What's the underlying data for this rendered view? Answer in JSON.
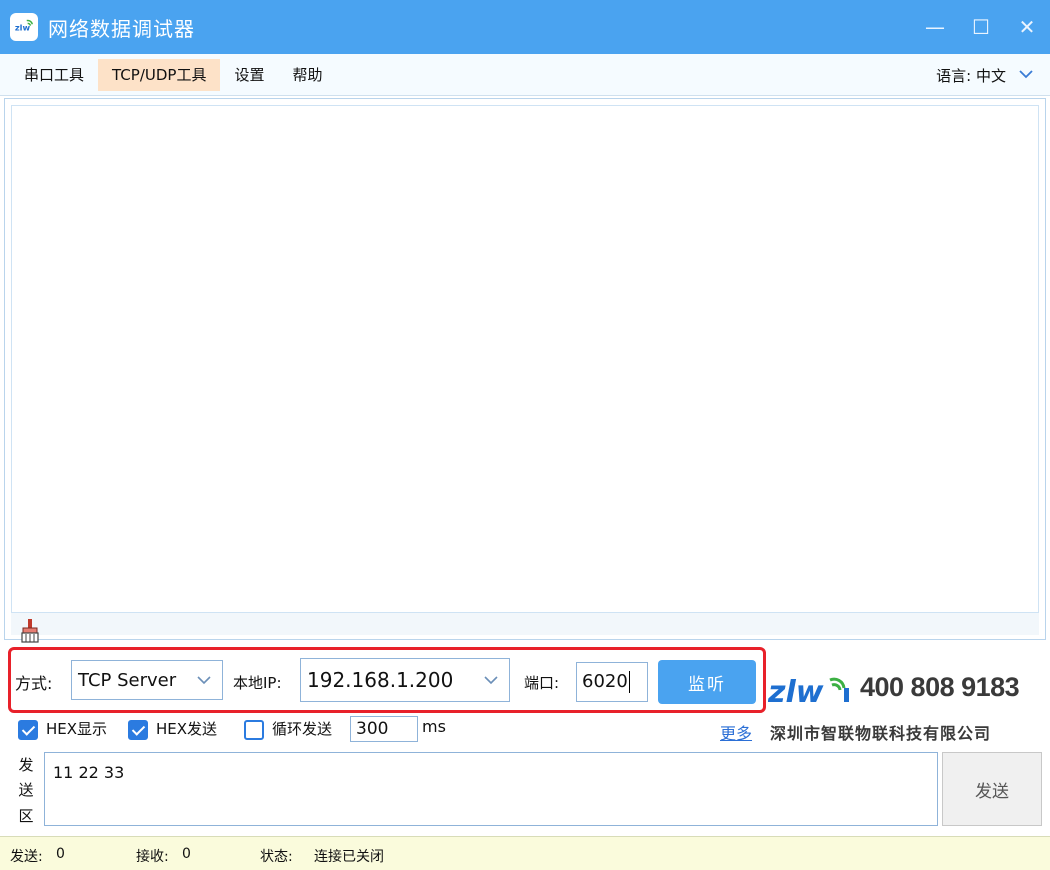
{
  "window": {
    "title": "网络数据调试器",
    "minimize": "—",
    "maximize": "☐",
    "close": "✕"
  },
  "menu": {
    "items": [
      "串口工具",
      "TCP/UDP工具",
      "设置",
      "帮助"
    ],
    "active": "TCP/UDP工具",
    "language_label": "语言: 中文"
  },
  "config": {
    "mode_label": "方式:",
    "mode_value": "TCP Server",
    "local_ip_label": "本地IP:",
    "local_ip_value": "192.168.1.200",
    "port_label": "端口:",
    "port_value": "6020",
    "listen_button": "监听"
  },
  "brand": {
    "phone": "400 808 9183",
    "company": "深圳市智联物联科技有限公司",
    "more_link": "更多"
  },
  "options": {
    "hex_display_label": "HEX显示",
    "hex_display_checked": true,
    "hex_send_label": "HEX发送",
    "hex_send_checked": true,
    "loop_send_label": "循环发送",
    "loop_send_checked": false,
    "interval_value": "300",
    "interval_unit": "ms"
  },
  "send": {
    "area_label": [
      "发",
      "送",
      "区"
    ],
    "content": "11 22 33",
    "send_button": "发送"
  },
  "status": {
    "sent_label": "发送:",
    "sent_count": "0",
    "recv_label": "接收:",
    "recv_count": "0",
    "state_label": "状态:",
    "state_value": "连接已关闭"
  },
  "colors": {
    "titlebar": "#4aa3f0",
    "menu_active": "#fde2c8",
    "highlight": "#e8212a",
    "checkbox": "#2b7be0",
    "statusbar": "#fafbdc"
  }
}
